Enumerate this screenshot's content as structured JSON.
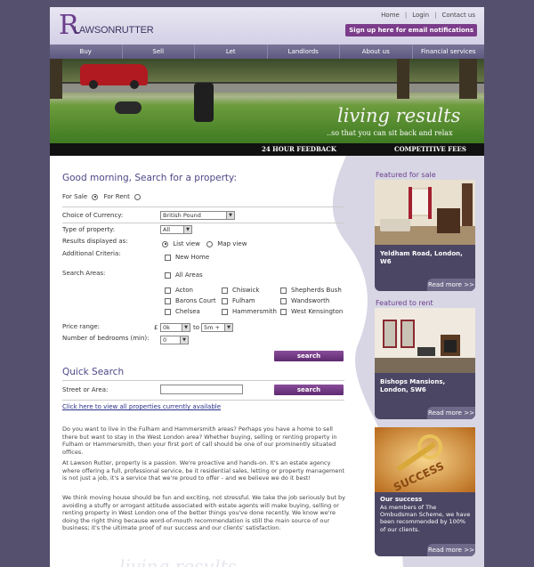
{
  "header": {
    "logo_mark": "R",
    "logo_text": "LAWSONRUTTER",
    "links": [
      "Home",
      "Login",
      "Contact us"
    ],
    "separator": "|",
    "signup_label": "Sign up here for email notifications"
  },
  "nav": [
    "Buy",
    "Sell",
    "Let",
    "Landlords",
    "About us",
    "Financial services"
  ],
  "hero": {
    "slogan": "living results",
    "tagline": "..so that you can sit back and relax"
  },
  "strip": {
    "left": "24 HOUR FEEDBACK",
    "right": "COMPETITIVE FEES"
  },
  "search": {
    "title": "Good morning, Search for a property:",
    "for_sale": "For Sale",
    "for_rent": "For Rent",
    "currency_label": "Choice of Currency:",
    "currency_value": "British Pound",
    "type_label": "Type of property:",
    "type_value": "All",
    "results_label": "Results displayed as:",
    "list_view": "List view",
    "map_view": "Map view",
    "additional_label": "Additional Criteria:",
    "new_home": "New Home",
    "areas_label": "Search Areas:",
    "all_areas": "All Areas",
    "areas": [
      "Acton",
      "Chiswick",
      "Shepherds Bush",
      "Barons Court",
      "Fulham",
      "Wandsworth",
      "Chelsea",
      "Hammersmith",
      "West Kensington"
    ],
    "price_label": "Price range:",
    "currency_symbol": "£",
    "price_min": "0k",
    "price_to": "to",
    "price_max": "5m +",
    "bedrooms_label": "Number of bedrooms (min):",
    "bedrooms_value": "0",
    "search_button": "search"
  },
  "quick_search": {
    "title": "Quick Search",
    "street_label": "Street or Area:",
    "search_button": "search",
    "view_all": "Click here to view all properties currently available"
  },
  "paragraphs": [
    "Do you want to live in the Fulham and Hammersmith areas? Perhaps you have a home to sell there but want to stay in the West London area? Whether buying, selling or renting property in Fulham or Hammersmith, then your first port of call should be one of our prominently situated offices.",
    "At Lawson Rutter, property is a passion. We're proactive and hands-on. It's an estate agency where offering a full, professional service, be it residential sales, letting or property management is not just a job, it's a service that we're proud to offer - and we believe we do it best!",
    "We think moving house should be fun and exciting, not stressful. We take the job seriously but by avoiding a stuffy or arrogant attitude associated with estate agents will make buying, selling or renting property in West London one of the better things you've done recently. We know we're doing the right thing because word-of-mouth recommendation is still the main source of our business; it's the ultimate proof of our success and our clients' satisfaction."
  ],
  "sidebar": {
    "featured_sale": {
      "heading": "Featured for sale",
      "caption": "Yeldham Road, London, W6",
      "read_more": "Read more >>"
    },
    "featured_rent": {
      "heading": "Featured to rent",
      "caption": "Bishops Mansions, London, SW6",
      "read_more": "Read more >>"
    },
    "success": {
      "photo_text": "SUCCESS",
      "title": "Our success",
      "text": "As members of The Ombudsman Scheme, we have been recommended by 100% of our clients.",
      "read_more": "Read more >>"
    }
  },
  "footer": {
    "watermark": "living results"
  }
}
